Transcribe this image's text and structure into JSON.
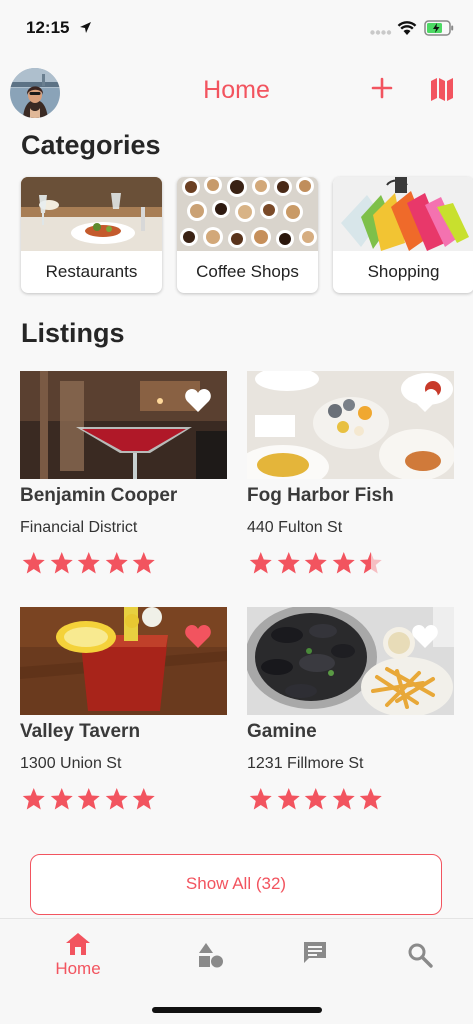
{
  "status_bar": {
    "time": "12:15"
  },
  "nav": {
    "title": "Home"
  },
  "colors": {
    "accent": "#f2545f",
    "star": "#f2545f"
  },
  "categories": {
    "title": "Categories",
    "items": [
      {
        "label": "Restaurants"
      },
      {
        "label": "Coffee Shops"
      },
      {
        "label": "Shopping"
      }
    ]
  },
  "listings": {
    "title": "Listings",
    "items": [
      {
        "name": "Benjamin Cooper",
        "address": "Financial District",
        "rating": 5,
        "favorite": false
      },
      {
        "name": "Fog Harbor Fish",
        "address": "440 Fulton St",
        "rating": 4.5,
        "favorite": false
      },
      {
        "name": "Valley Tavern",
        "address": "1300 Union St",
        "rating": 5,
        "favorite": true
      },
      {
        "name": "Gamine",
        "address": "1231 Fillmore St",
        "rating": 5,
        "favorite": false
      }
    ],
    "show_all_label": "Show All (32)"
  },
  "tabbar": {
    "tabs": [
      {
        "icon": "home-icon",
        "label": "Home",
        "active": true
      },
      {
        "icon": "categories-icon",
        "active": false
      },
      {
        "icon": "chat-icon",
        "active": false
      },
      {
        "icon": "search-icon",
        "active": false
      }
    ]
  }
}
